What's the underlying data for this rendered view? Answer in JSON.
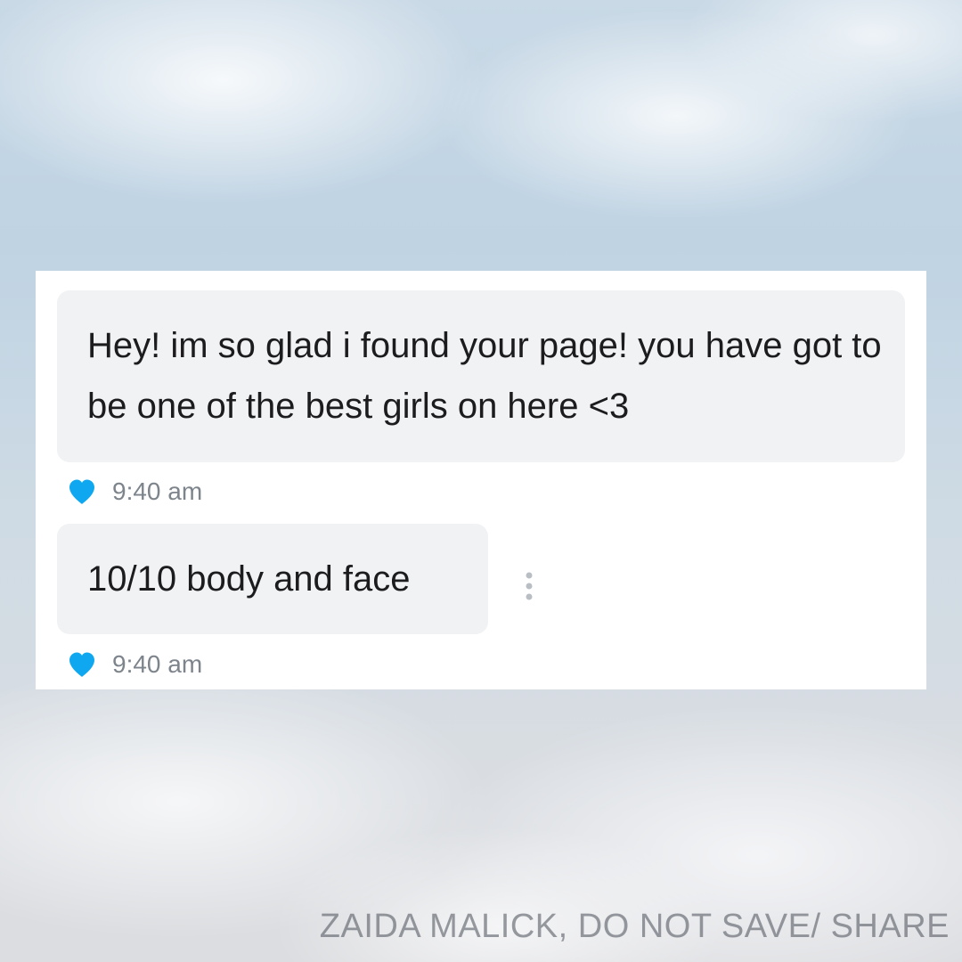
{
  "messages": [
    {
      "text": "Hey! im so glad i found your page! you have got to be one of the best girls on here <3",
      "time": "9:40 am",
      "liked": true
    },
    {
      "text": "10/10 body and face",
      "time": "9:40 am",
      "liked": true
    }
  ],
  "icons": {
    "like": "heart-icon",
    "options": "more-vertical-icon"
  },
  "colors": {
    "heart": "#0fa8f0",
    "bubble": "#f1f2f4",
    "timestamp": "#7d848c"
  },
  "watermark": "ZAIDA MALICK, DO NOT SAVE/ SHARE"
}
